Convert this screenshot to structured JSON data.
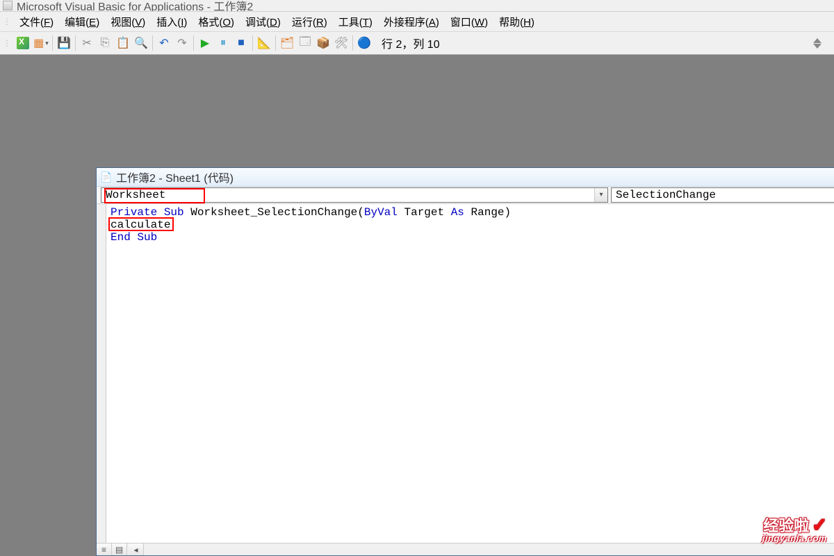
{
  "title": {
    "app": "Microsoft Visual Basic for Applications",
    "sep": " - ",
    "doc": "工作簿2"
  },
  "menu": {
    "file": "文件(F)",
    "edit": "编辑(E)",
    "view": "视图(V)",
    "insert": "插入(I)",
    "format": "格式(O)",
    "debug": "调试(D)",
    "run": "运行(R)",
    "tools": "工具(T)",
    "addins": "外接程序(A)",
    "window": "窗口(W)",
    "help": "帮助(H)"
  },
  "toolbar": {
    "icons": {
      "excel": "excel-icon",
      "addform": "add-form-icon",
      "save": "save-icon",
      "cut": "cut-icon",
      "copy": "copy-icon",
      "paste": "paste-icon",
      "find": "find-icon",
      "undo": "undo-icon",
      "redo": "redo-icon",
      "run": "run-icon",
      "break": "break-icon",
      "stop": "stop-icon",
      "design": "design-mode-icon",
      "project": "project-explorer-icon",
      "properties": "properties-icon",
      "browser": "object-browser-icon",
      "toolbox": "toolbox-icon",
      "help": "help-icon"
    },
    "status": "行 2，列 10"
  },
  "code_window": {
    "title": "工作簿2 - Sheet1 (代码)",
    "object_dd": "Worksheet",
    "proc_dd": "SelectionChange",
    "code": {
      "l1_a": "Private Sub",
      "l1_b": " Worksheet_SelectionChange(",
      "l1_c": "ByVal",
      "l1_d": " Target ",
      "l1_e": "As",
      "l1_f": " Range)",
      "l2": "calculate",
      "l3": "End Sub"
    }
  },
  "watermark": {
    "main": "经验啦",
    "sub": "jingyanla.com"
  }
}
